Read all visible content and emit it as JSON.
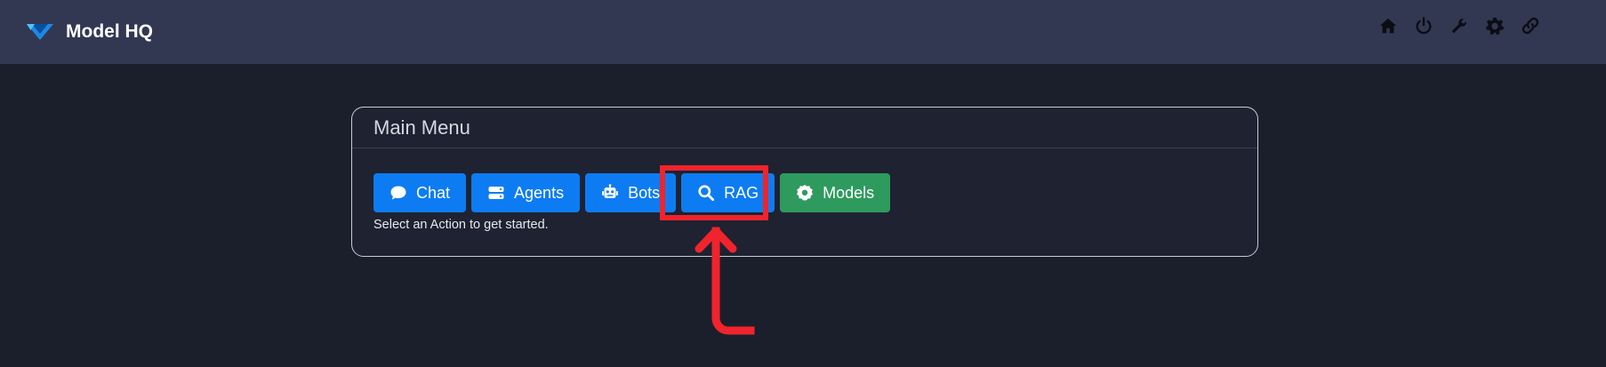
{
  "app": {
    "title": "Model HQ"
  },
  "nav": {
    "icons": [
      "home-icon",
      "power-icon",
      "wrench-icon",
      "gear-icon",
      "link-icon"
    ]
  },
  "main_menu": {
    "title": "Main Menu",
    "buttons": [
      {
        "label": "Chat",
        "icon": "chat-bubble-icon",
        "color": "#0d7cf2"
      },
      {
        "label": "Agents",
        "icon": "server-icon",
        "color": "#0d7cf2"
      },
      {
        "label": "Bots",
        "icon": "robot-icon",
        "color": "#0d7cf2"
      },
      {
        "label": "RAG",
        "icon": "search-icon",
        "color": "#0d7cf2"
      },
      {
        "label": "Models",
        "icon": "cog-icon",
        "color": "#2e9a5e"
      }
    ],
    "helper_text": "Select an Action to get started."
  },
  "annotation": {
    "highlight_color": "#f0242c",
    "highlighted_button": "RAG"
  },
  "colors": {
    "background": "#1b1f2c",
    "navbar": "#323851",
    "primary": "#0d7cf2",
    "success": "#2e9a5e"
  }
}
